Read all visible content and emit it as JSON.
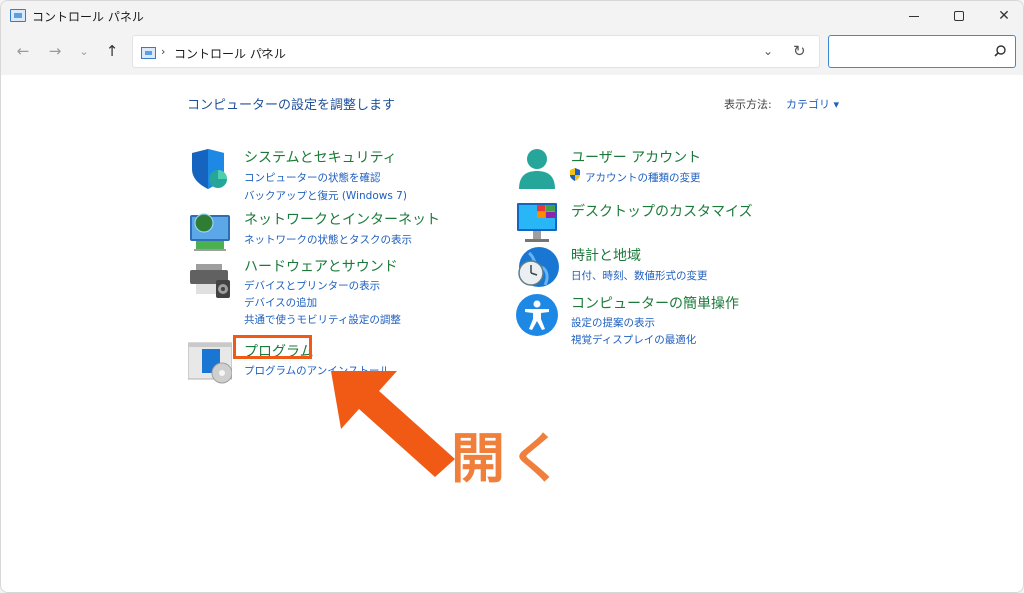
{
  "window": {
    "title": "コントロール パネル",
    "controls": {
      "minimize": "minimize",
      "maximize": "maximize",
      "close": "✕"
    }
  },
  "nav": {
    "back": "←",
    "forward": "→",
    "recent": "⌄",
    "up": "↑",
    "address": {
      "separator": "›",
      "path": "コントロール パネル",
      "dropdown": "⌄",
      "refresh": "↻"
    },
    "search": {
      "value": "",
      "placeholder": ""
    }
  },
  "content": {
    "title": "コンピューターの設定を調整します",
    "view_by_label": "表示方法:",
    "view_by_value": "カテゴリ ▾",
    "left_categories": [
      {
        "title": "システムとセキュリティ",
        "icon": "shield-icon",
        "links": [
          "コンピューターの状態を確認",
          "バックアップと復元 (Windows 7)"
        ]
      },
      {
        "title": "ネットワークとインターネット",
        "icon": "network-icon",
        "links": [
          "ネットワークの状態とタスクの表示"
        ]
      },
      {
        "title": "ハードウェアとサウンド",
        "icon": "printer-icon",
        "links": [
          "デバイスとプリンターの表示",
          "デバイスの追加",
          "共通で使うモビリティ設定の調整"
        ]
      },
      {
        "title": "プログラム",
        "icon": "programs-icon",
        "links": [
          "プログラムのアンインストール"
        ]
      }
    ],
    "right_categories": [
      {
        "title": "ユーザー アカウント",
        "icon": "user-icon",
        "links": [
          "アカウントの種類の変更"
        ]
      },
      {
        "title": "デスクトップのカスタマイズ",
        "icon": "desktop-icon",
        "links": []
      },
      {
        "title": "時計と地域",
        "icon": "clock-globe-icon",
        "links": [
          "日付、時刻、数値形式の変更"
        ]
      },
      {
        "title": "コンピューターの簡単操作",
        "icon": "accessibility-icon",
        "links": [
          "設定の提案の表示",
          "視覚ディスプレイの最適化"
        ]
      }
    ]
  },
  "annotation": {
    "text": "開く",
    "color": "#f07f3c",
    "box_color": "#f05a14"
  },
  "colors": {
    "link": "#1e5fbf",
    "category_title": "#1b7a3a",
    "page_title": "#1e4f9b"
  }
}
